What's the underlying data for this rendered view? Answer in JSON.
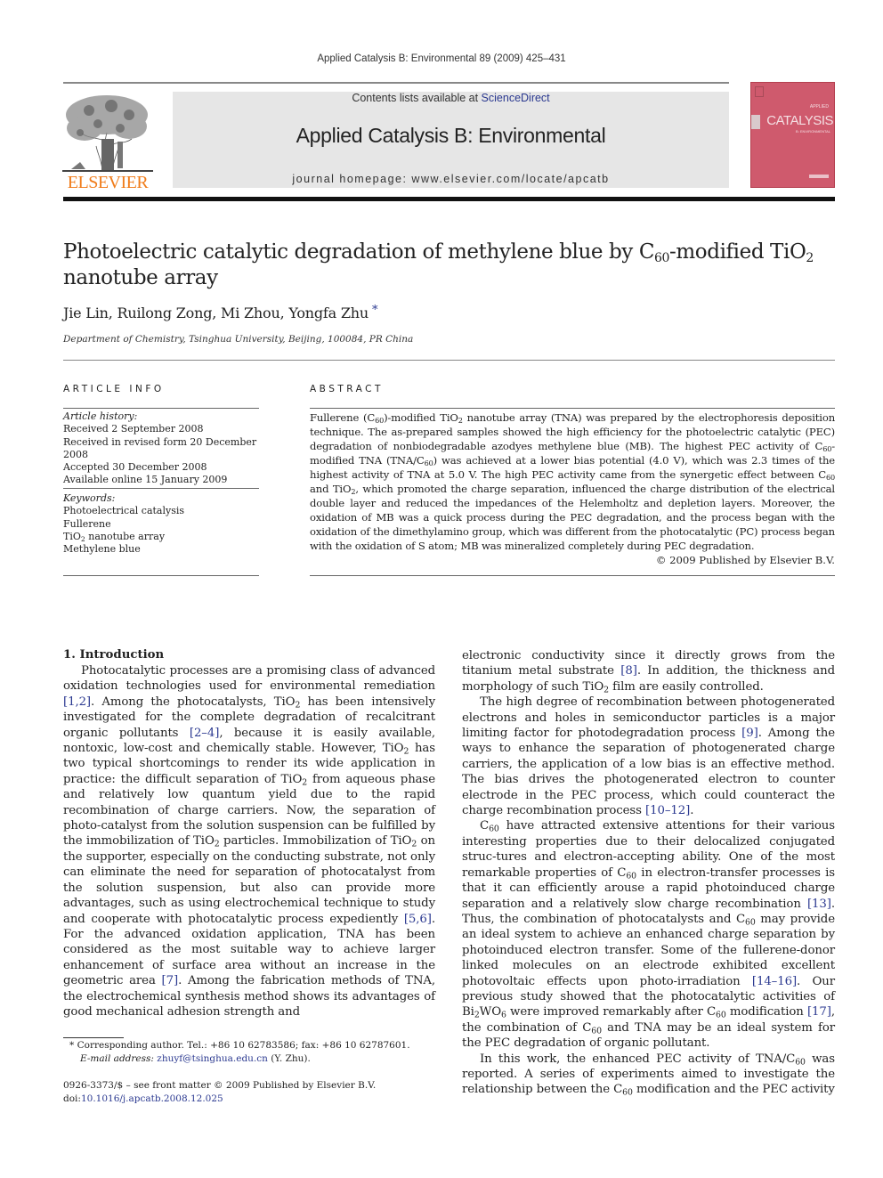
{
  "running_head": "Applied Catalysis B: Environmental 89 (2009) 425–431",
  "header": {
    "contents_prefix": "Contents lists available at ",
    "contents_link": "ScienceDirect",
    "journal_title": "Applied Catalysis B: Environmental",
    "homepage_label": "journal homepage: www.elsevier.com/locate/apcatb",
    "publisher_logo_text": "ELSEVIER",
    "cover": {
      "top_text": "APPLIED",
      "title": "CATALYSIS",
      "subtitle": "B: ENVIRONMENTAL",
      "color": "#cf5a6d"
    },
    "brand_color": "#f07c1a",
    "link_color": "#2b3990"
  },
  "article": {
    "title_part1": "Photoelectric catalytic degradation of methylene blue by C",
    "title_sub1": "60",
    "title_part2": "-modified TiO",
    "title_sub2": "2",
    "title_part3": " nanotube array",
    "authors": "Jie Lin, Ruilong Zong, Mi Zhou, Yongfa Zhu",
    "corresponding_mark": "*",
    "affiliation": "Department of Chemistry, Tsinghua University, Beijing, 100084, PR China"
  },
  "article_info": {
    "heading": "ARTICLE INFO",
    "history_label": "Article history:",
    "history": [
      "Received 2 September 2008",
      "Received in revised form 20 December 2008",
      "Accepted 30 December 2008",
      "Available online 15 January 2009"
    ],
    "keywords_label": "Keywords:",
    "keywords": [
      "Photoelectrical catalysis",
      "Fullerene",
      "TiO2 nanotube array",
      "Methylene blue"
    ]
  },
  "abstract": {
    "heading": "ABSTRACT",
    "text": "Fullerene (C60)-modified TiO2 nanotube array (TNA) was prepared by the electrophoresis deposition technique. The as-prepared samples showed the high efficiency for the photoelectric catalytic (PEC) degradation of nonbiodegradable azodyes methylene blue (MB). The highest PEC activity of C60-modified TNA (TNA/C60) was achieved at a lower bias potential (4.0 V), which was 2.3 times of the highest activity of TNA at 5.0 V. The high PEC activity came from the synergetic effect between C60 and TiO2, which promoted the charge separation, influenced the charge distribution of the electrical double layer and reduced the impedances of the Helemholtz and depletion layers. Moreover, the oxidation of MB was a quick process during the PEC degradation, and the process began with the oxidation of the dimethylamino group, which was different from the photocatalytic (PC) process began with the oxidation of S atom; MB was mineralized completely during PEC degradation.",
    "copyright": "© 2009 Published by Elsevier B.V."
  },
  "introduction": {
    "heading": "1.  Introduction",
    "left_paragraphs": [
      "Photocatalytic processes are a promising class of advanced oxidation technologies used for environmental remediation [1,2]. Among the photocatalysts, TiO2 has been intensively investigated for the complete degradation of recalcitrant organic pollutants [2–4], because it is easily available, nontoxic, low-cost and chemically stable. However, TiO2 has two typical shortcomings to render its wide application in practice: the difficult separation of TiO2 from aqueous phase and relatively low quantum yield due to the rapid recombination of charge carriers. Now, the separation of photo-catalyst from the solution suspension can be fulfilled by the immobilization of TiO2 particles. Immobilization of TiO2 on the supporter, especially on the conducting substrate, not only can eliminate the need for separation of photocatalyst from the solution suspension, but also can provide more advantages, such as using electrochemical technique to study and cooperate with photocatalytic process expediently [5,6]. For the advanced oxidation application, TNA has been considered as the most suitable way to achieve larger enhancement of surface area without an increase in the geometric area [7]. Among the fabrication methods of TNA, the electrochemical synthesis method shows its advantages of good mechanical adhesion strength and"
    ],
    "right_paragraphs": [
      "electronic conductivity since it directly grows from the titanium metal substrate [8]. In addition, the thickness and morphology of such TiO2 film are easily controlled.",
      "The high degree of recombination between photogenerated electrons and holes in semiconductor particles is a major limiting factor for photodegradation process [9]. Among the ways to enhance the separation of photogenerated charge carriers, the application of a low bias is an effective method. The bias drives the photogenerated electron to counter electrode in the PEC process, which could counteract the charge recombination process [10–12].",
      "C60 have attracted extensive attentions for their various interesting properties due to their delocalized conjugated struc-tures and electron-accepting ability. One of the most remarkable properties of C60 in electron-transfer processes is that it can efficiently arouse a rapid photoinduced charge separation and a relatively slow charge recombination [13]. Thus, the combination of photocatalysts and C60 may provide an ideal system to achieve an enhanced charge separation by photoinduced electron transfer. Some of the fullerene-donor linked molecules on an electrode exhibited excellent photovoltaic effects upon photo-irradiation [14–16]. Our previous study showed that the photocatalytic activities of Bi2WO6 were improved remarkably after C60 modification [17], the combination of C60 and TNA may be an ideal system for the PEC degradation of organic pollutant.",
      "In this work, the enhanced PEC activity of TNA/C60 was reported. A series of experiments aimed to investigate the relationship between the C60 modification and the PEC activity"
    ]
  },
  "footnotes": {
    "corresponding": "* Corresponding author. Tel.: +86 10 62783586; fax: +86 10 62787601.",
    "email_label": "E-mail address: ",
    "email": "zhuyf@tsinghua.edu.cn",
    "email_suffix": " (Y. Zhu).",
    "front_matter": "0926-3373/$ – see front matter © 2009 Published by Elsevier B.V.",
    "doi_prefix": "doi:",
    "doi": "10.1016/j.apcatb.2008.12.025"
  }
}
